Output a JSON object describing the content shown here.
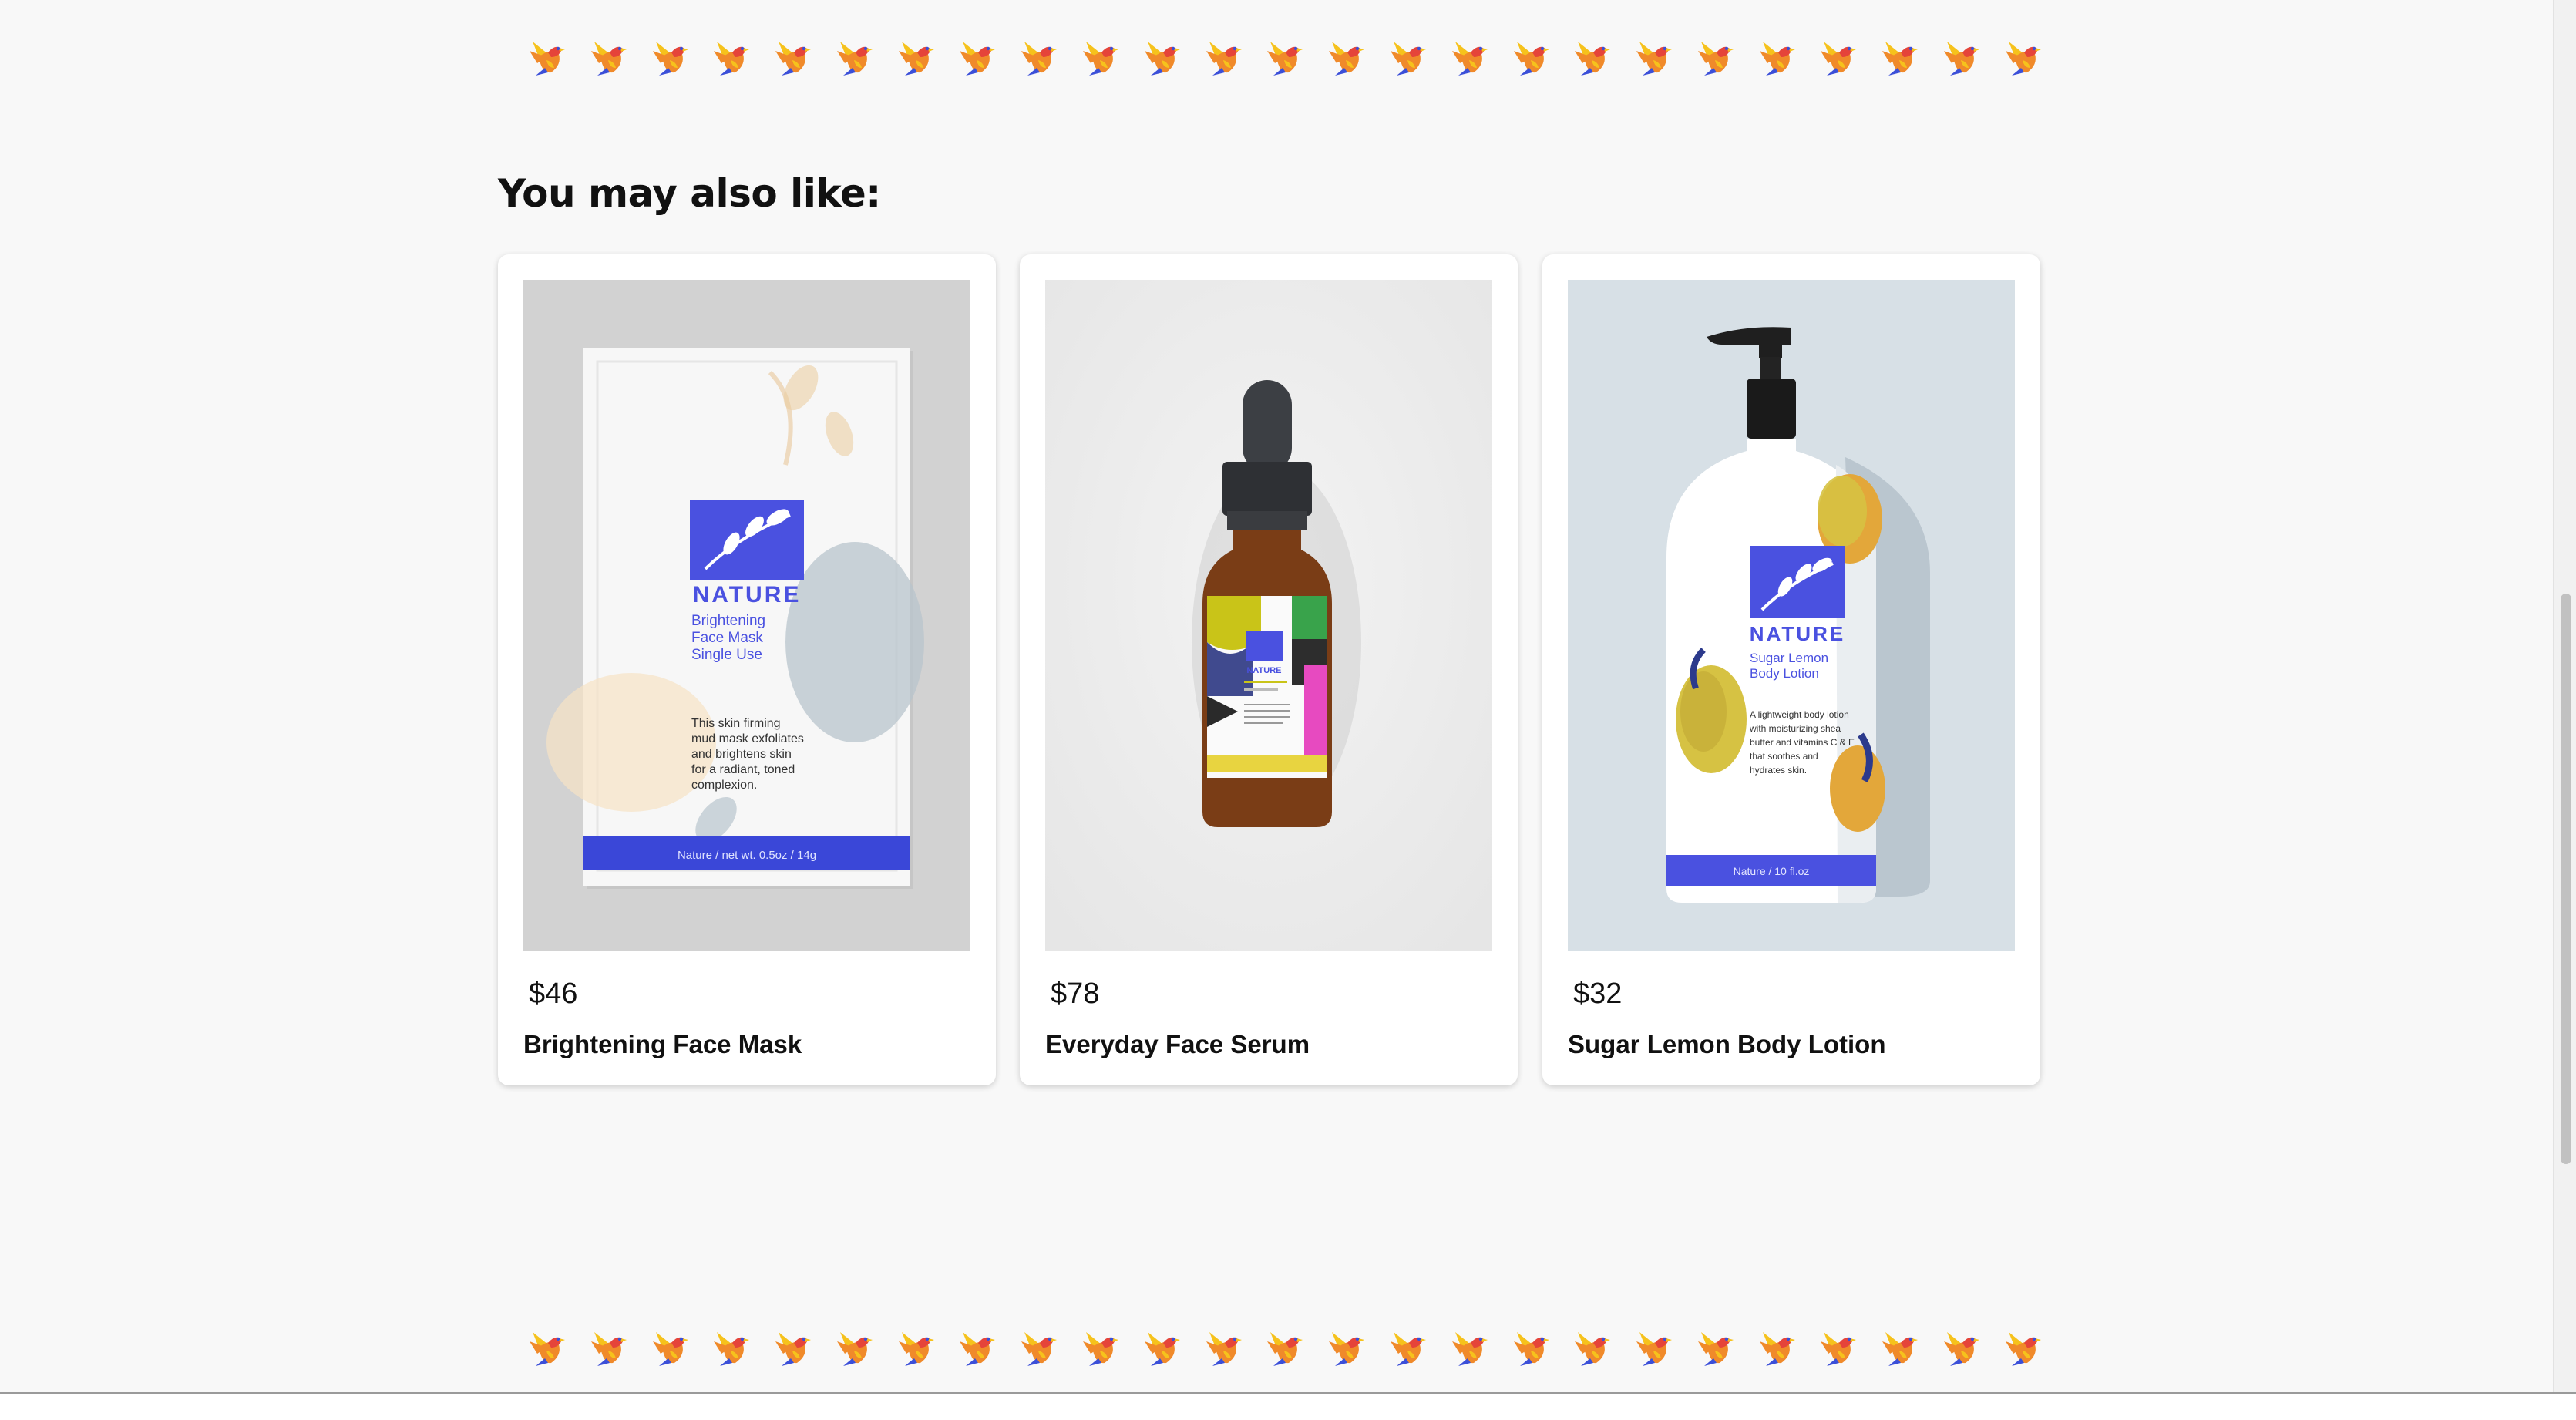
{
  "section": {
    "title": "You may also like:"
  },
  "decorations": {
    "icon": "bird-icon",
    "count_per_row": 25,
    "colors": {
      "yellow": "#f6c21c",
      "orange": "#f08a2a",
      "red": "#e5443a",
      "blue": "#3b4fd8"
    }
  },
  "products": [
    {
      "price": "$46",
      "name": "Brightening Face Mask",
      "package": {
        "brand": "NATURE",
        "title_lines": [
          "Brightening",
          "Face Mask",
          "Single Use"
        ],
        "description_lines": [
          "This skin firming",
          "mud mask exfoliates",
          "and brightens skin",
          "for a radiant, toned",
          "complexion."
        ],
        "footer": "Nature / net  wt. 0.5oz / 14g"
      }
    },
    {
      "price": "$78",
      "name": "Everyday Face Serum",
      "package": {
        "brand": "NATURE"
      }
    },
    {
      "price": "$32",
      "name": "Sugar Lemon Body Lotion",
      "package": {
        "brand": "NATURE",
        "title_lines": [
          "Sugar Lemon",
          "Body Lotion"
        ],
        "description_lines": [
          "A lightweight body lotion",
          "with moisturizing shea",
          "butter and vitamins C & E",
          "that soothes and",
          "hydrates skin."
        ],
        "footer": "Nature /  10 fl.oz"
      }
    }
  ],
  "colors": {
    "brand_blue": "#4a51e0",
    "background": "#f8f8f8",
    "card": "#ffffff"
  }
}
